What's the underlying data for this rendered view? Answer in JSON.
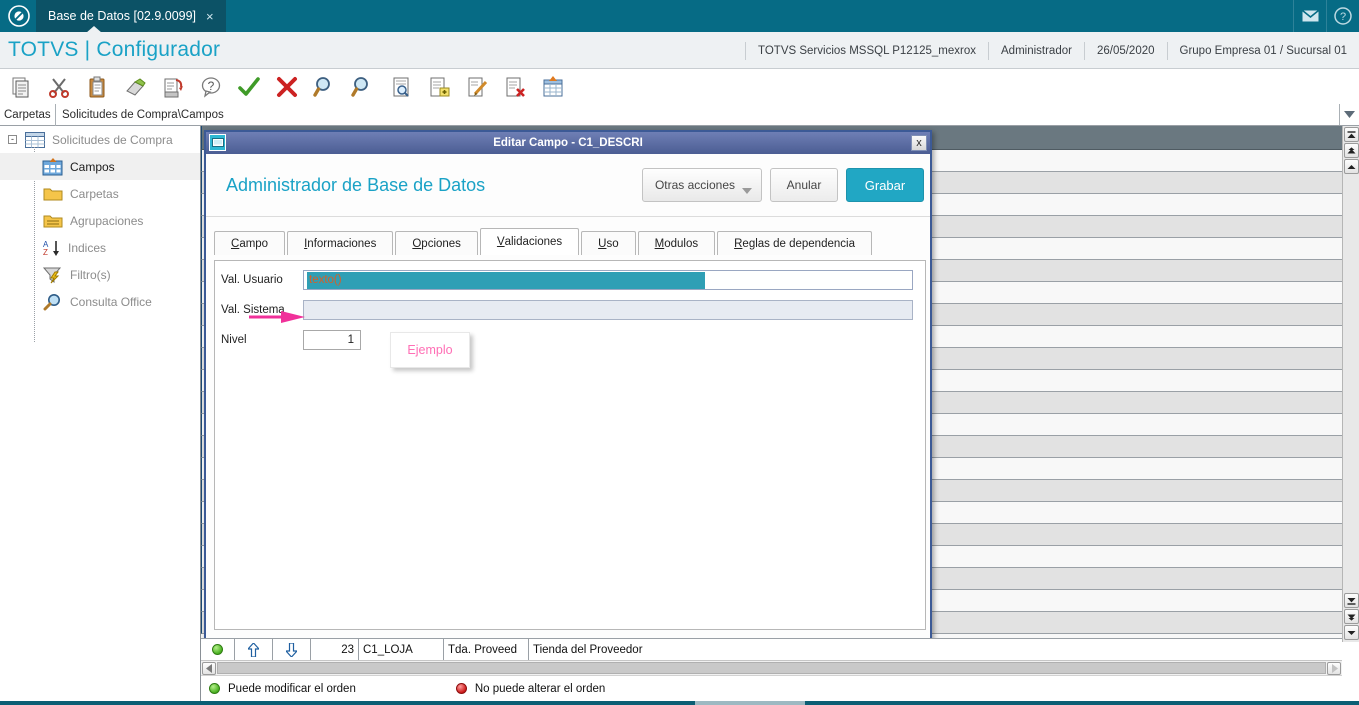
{
  "titlebar": {
    "logo_icon": "totvs-logo-icon",
    "tab_label": "Base de Datos [02.9.0099]",
    "tab_close": "×",
    "mail_icon": "mail-icon",
    "help_icon": "help-icon"
  },
  "brandbar": {
    "title": "TOTVS | Configurador",
    "context": [
      "TOTVS Servicios MSSQL P12125_mexrox",
      "Administrador",
      "26/05/2020",
      "Grupo Empresa 01 / Sucursal 01"
    ]
  },
  "toolbar": {
    "items": [
      {
        "name": "copy-document-icon"
      },
      {
        "name": "cut-scissors-icon"
      },
      {
        "name": "paste-clipboard-icon"
      },
      {
        "name": "eraser-icon"
      },
      {
        "name": "print-preview-icon"
      },
      {
        "name": "help-question-icon"
      },
      {
        "name": "confirm-check-icon"
      },
      {
        "name": "cancel-x-icon"
      },
      {
        "name": "search-magnifier-icon"
      },
      {
        "name": "search-magnifier-alt-icon"
      },
      {
        "name": "view-document-icon"
      },
      {
        "name": "new-document-icon"
      },
      {
        "name": "edit-document-icon"
      },
      {
        "name": "delete-document-icon"
      },
      {
        "name": "table-import-icon"
      }
    ]
  },
  "breadcrumb": {
    "label": "Carpetas",
    "path": "Solicitudes de Compra\\Campos",
    "dropdown_icon": "chevron-down-icon"
  },
  "tree": {
    "root": {
      "label": "Solicitudes de Compra",
      "icon": "table-icon",
      "expander": "-"
    },
    "items": [
      {
        "label": "Campos",
        "icon": "table-fields-icon",
        "selected": true
      },
      {
        "label": "Carpetas",
        "icon": "folder-icon",
        "selected": false
      },
      {
        "label": "Agrupaciones",
        "icon": "folder-lines-icon",
        "selected": false
      },
      {
        "label": "Indices",
        "icon": "sort-az-icon",
        "selected": false
      },
      {
        "label": "Filtro(s)",
        "icon": "filter-icon",
        "selected": false
      },
      {
        "label": "Consulta Office",
        "icon": "magnifier-icon",
        "selected": false
      }
    ]
  },
  "dialog": {
    "title": "Editar Campo - C1_DESCRI",
    "window_icon": "window-icon",
    "close_label": "x",
    "app_title": "Administrador de Base de Datos",
    "buttons": {
      "other_actions": "Otras acciones",
      "cancel": "Anular",
      "save": "Grabar"
    },
    "tabs": [
      {
        "accel": "C",
        "rest": "ampo",
        "active": false
      },
      {
        "accel": "I",
        "rest": "nformaciones",
        "active": false
      },
      {
        "accel": "O",
        "rest": "pciones",
        "active": false
      },
      {
        "accel": "V",
        "rest": "alidaciones",
        "active": true
      },
      {
        "accel": "U",
        "rest": "so",
        "active": false
      },
      {
        "accel": "M",
        "rest": "odulos",
        "active": false
      },
      {
        "accel": "R",
        "rest": "eglas de dependencia",
        "active": false
      }
    ],
    "form": {
      "val_usuario_label": "Val. Usuario",
      "val_usuario_value": "texto()",
      "val_sistema_label": "Val. Sistema",
      "val_sistema_value": "",
      "nivel_label": "Nivel",
      "nivel_value": "1"
    },
    "annotation": {
      "arrow_icon": "pink-arrow-icon",
      "callout_text": "Ejemplo",
      "arrow_color": "#f0319a",
      "text_color": "#ff6fb5"
    }
  },
  "grid": {
    "row_count": 23,
    "scroll": {
      "up_top_icon": "scroll-top-icon",
      "up_icon": "scroll-up-icon",
      "up_small_icon": "scroll-line-up-icon",
      "down_icon": "scroll-down-icon",
      "down_bottom_icon": "scroll-bottom-icon"
    }
  },
  "bottom_record": {
    "status_icon": "green-led-icon",
    "move_up_icon": "arrow-up-icon",
    "move_down_icon": "arrow-down-icon",
    "order": "23",
    "field": "C1_LOJA",
    "short_label": "Tda. Proveed",
    "description": "Tienda del Proveedor"
  },
  "hscroll": {
    "left_icon": "arrow-left-icon",
    "right_icon": "arrow-right-icon"
  },
  "legend": {
    "can_modify": "Puede modificar el orden",
    "cannot_modify": "No puede alterar el orden"
  },
  "colors": {
    "teal_header": "#066b85",
    "brand_cyan": "#1aa2c6",
    "primary_button": "#21a7c4",
    "dialog_title": "#4b5d93",
    "selection_teal": "#2f9fb5",
    "annotation_pink": "#f0319a"
  }
}
